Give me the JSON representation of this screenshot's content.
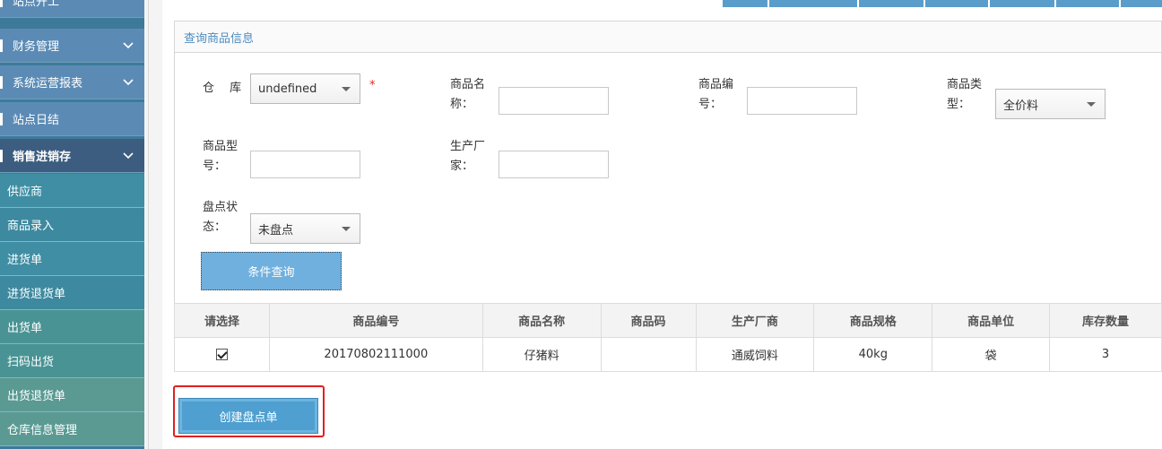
{
  "sidebar": {
    "top_items": [
      {
        "label": "站点开工"
      },
      {
        "label": "财务管理"
      },
      {
        "label": "系统运营报表"
      },
      {
        "label": "站点日结"
      },
      {
        "label": "销售进销存"
      }
    ],
    "sub_items": [
      {
        "label": "供应商"
      },
      {
        "label": "商品录入"
      },
      {
        "label": "进货单"
      },
      {
        "label": "进货退货单"
      },
      {
        "label": "出货单"
      },
      {
        "label": "扫码出货"
      },
      {
        "label": "出货退货单"
      },
      {
        "label": "仓库信息管理"
      }
    ]
  },
  "panel": {
    "title": "查询商品信息"
  },
  "form": {
    "warehouse_label": "仓　 库",
    "warehouse_value": "undefined",
    "required_mark": "*",
    "product_name_label": "商品名称：",
    "product_code_label": "商品编号：",
    "product_type_label": "商品类型：",
    "product_type_value": "全价料",
    "product_model_label": "商品型号：",
    "manufacturer_label": "生产厂家：",
    "inventory_status_label": "盘点状态：",
    "inventory_status_value": "未盘点",
    "query_button": "条件查询"
  },
  "table": {
    "headers": [
      "请选择",
      "商品编号",
      "商品名称",
      "商品码",
      "生产厂商",
      "商品规格",
      "商品单位",
      "库存数量"
    ],
    "rows": [
      {
        "checked": true,
        "code": "20170802111000",
        "name": "仔猪料",
        "barcode": "",
        "maker": "通威饲料",
        "spec": "40kg",
        "unit": "袋",
        "qty": "3"
      }
    ]
  },
  "actions": {
    "create_inventory": "创建盘点单"
  },
  "colors": {
    "accent": "#4f8cc0",
    "highlight": "#e02020"
  }
}
